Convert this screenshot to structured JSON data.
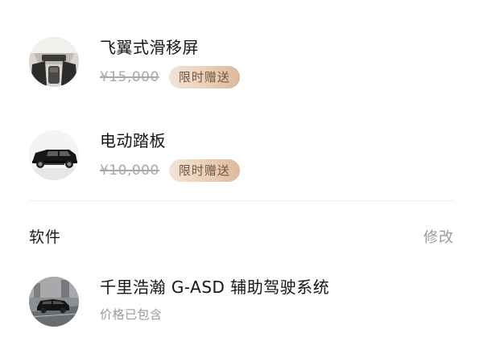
{
  "hardware_items": [
    {
      "title": "飞翼式滑移屏",
      "original_price": "¥15,000",
      "badge": "限时赠送",
      "thumbnail_icon": "car-interior-screen-thumbnail"
    },
    {
      "title": "电动踏板",
      "original_price": "¥10,000",
      "badge": "限时赠送",
      "thumbnail_icon": "car-side-step-thumbnail"
    }
  ],
  "software_section": {
    "title": "软件",
    "edit_label": "修改",
    "items": [
      {
        "title": "千里浩瀚 G-ASD 辅助驾驶系统",
        "subtitle": "价格已包含",
        "thumbnail_icon": "car-driving-assist-thumbnail"
      }
    ]
  },
  "colors": {
    "badge_gradient_start": "#f3e4d6",
    "badge_gradient_end": "#dcb89c",
    "badge_text": "#6d5640",
    "muted_text": "#9b9b9b"
  }
}
